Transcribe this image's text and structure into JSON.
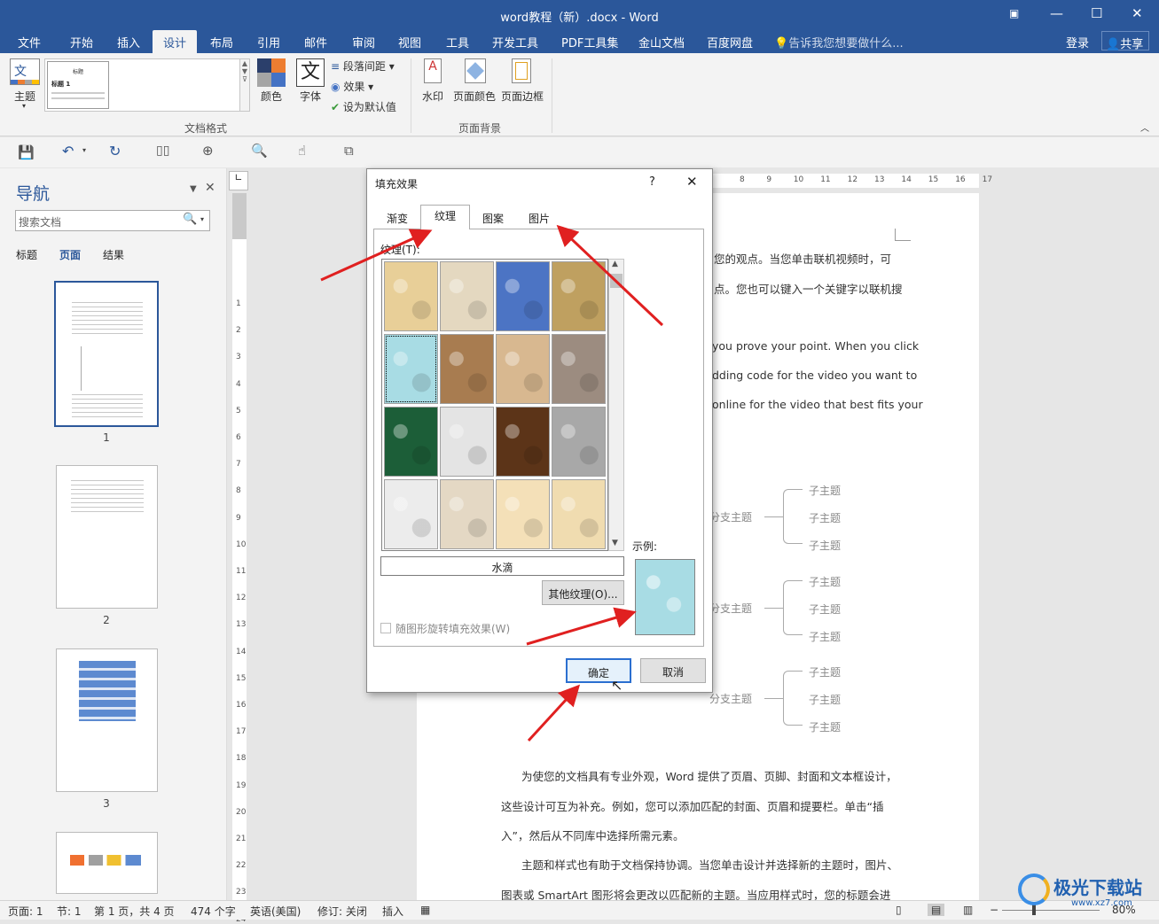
{
  "window": {
    "title": "word教程（新）.docx - Word"
  },
  "ribbon_tabs": [
    "文件",
    "开始",
    "插入",
    "设计",
    "布局",
    "引用",
    "邮件",
    "审阅",
    "视图",
    "工具",
    "开发工具",
    "PDF工具集",
    "金山文档",
    "百度网盘"
  ],
  "tellme": "告诉我您想要做什么...",
  "login": "登录",
  "share": "共享",
  "ribbon": {
    "theme": "主题",
    "style_title": "标题",
    "style_heading1": "标题 1",
    "colors": "颜色",
    "fonts": "字体",
    "fonts_glyph": "文",
    "para_spacing": "段落间距",
    "effects": "效果",
    "set_default": "设为默认值",
    "group_docformat": "文档格式",
    "watermark": "水印",
    "page_color": "页面颜色",
    "page_border": "页面边框",
    "group_background": "页面背景"
  },
  "nav": {
    "title": "导航",
    "search_placeholder": "搜索文档",
    "tabs": [
      "标题",
      "页面",
      "结果"
    ],
    "pages": [
      "1",
      "2",
      "3"
    ]
  },
  "ruler_top": [
    "8",
    "9",
    "10",
    "11",
    "12",
    "13",
    "14",
    "15",
    "16",
    "17"
  ],
  "ruler_left": [
    "1",
    "2",
    "3",
    "4",
    "5",
    "6",
    "7",
    "8",
    "9",
    "10",
    "11",
    "12",
    "13",
    "14",
    "15",
    "16",
    "17",
    "18",
    "19",
    "20",
    "21",
    "22",
    "23",
    "24"
  ],
  "dialog": {
    "title": "填充效果",
    "help": "?",
    "tabs": [
      "渐变",
      "纹理",
      "图案",
      "图片"
    ],
    "texture_label": "纹理(T):",
    "selected_name": "水滴",
    "more_textures": "其他纹理(O)...",
    "sample_label": "示例:",
    "rotate_checkbox": "随图形旋转填充效果(W)",
    "ok": "确定",
    "cancel": "取消"
  },
  "textures": [
    {
      "name": "纸莎草纸",
      "color": "#e8cf98"
    },
    {
      "name": "画布",
      "color": "#e4d8c0"
    },
    {
      "name": "斜纹布",
      "color": "#4c74c4"
    },
    {
      "name": "编织物",
      "color": "#bfa060"
    },
    {
      "name": "水滴",
      "color": "#a8dce4"
    },
    {
      "name": "纸袋",
      "color": "#a87c50"
    },
    {
      "name": "鱼类化石",
      "color": "#d8b890"
    },
    {
      "name": "沙滩",
      "color": "#9c8c80"
    },
    {
      "name": "绿色大理石",
      "color": "#1c5e38"
    },
    {
      "name": "白色大理石",
      "color": "#e4e4e4"
    },
    {
      "name": "棕色大理石",
      "color": "#5c3418"
    },
    {
      "name": "花岗岩",
      "color": "#a8a8a8"
    },
    {
      "name": "新闻纸",
      "color": "#ececec"
    },
    {
      "name": "再生纸",
      "color": "#e4d8c4"
    },
    {
      "name": "羊皮纸",
      "color": "#f4e0b8"
    },
    {
      "name": "信纸",
      "color": "#f0dcb0"
    }
  ],
  "document": {
    "lines_top": [
      "您的观点。当您单击联机视频时，可",
      "点。您也可以键入一个关键字以联机搜",
      "you prove your point. When you click",
      "dding code for the video you want to",
      "online for the video that best fits your"
    ],
    "branch": "分支主题",
    "sub": "子主题",
    "lines_bottom": [
      "为使您的文档具有专业外观，Word 提供了页眉、页脚、封面和文本框设计，",
      "这些设计可互为补充。例如，您可以添加匹配的封面、页眉和提要栏。单击“插",
      "入”，然后从不同库中选择所需元素。",
      "主题和样式也有助于文档保持协调。当您单击设计并选择新的主题时，图片、",
      "图表或 SmartArt 图形将会更改以匹配新的主题。当应用样式时，您的标题会进"
    ]
  },
  "status": {
    "page": "页面: 1",
    "section": "节: 1",
    "pageof": "第 1 页，共 4 页",
    "words": "474 个字",
    "lang": "英语(美国)",
    "track": "修订: 关闭",
    "insert": "插入",
    "zoom": "80%"
  },
  "watermark": {
    "site": "极光下载站",
    "url": "www.xz7.com"
  }
}
